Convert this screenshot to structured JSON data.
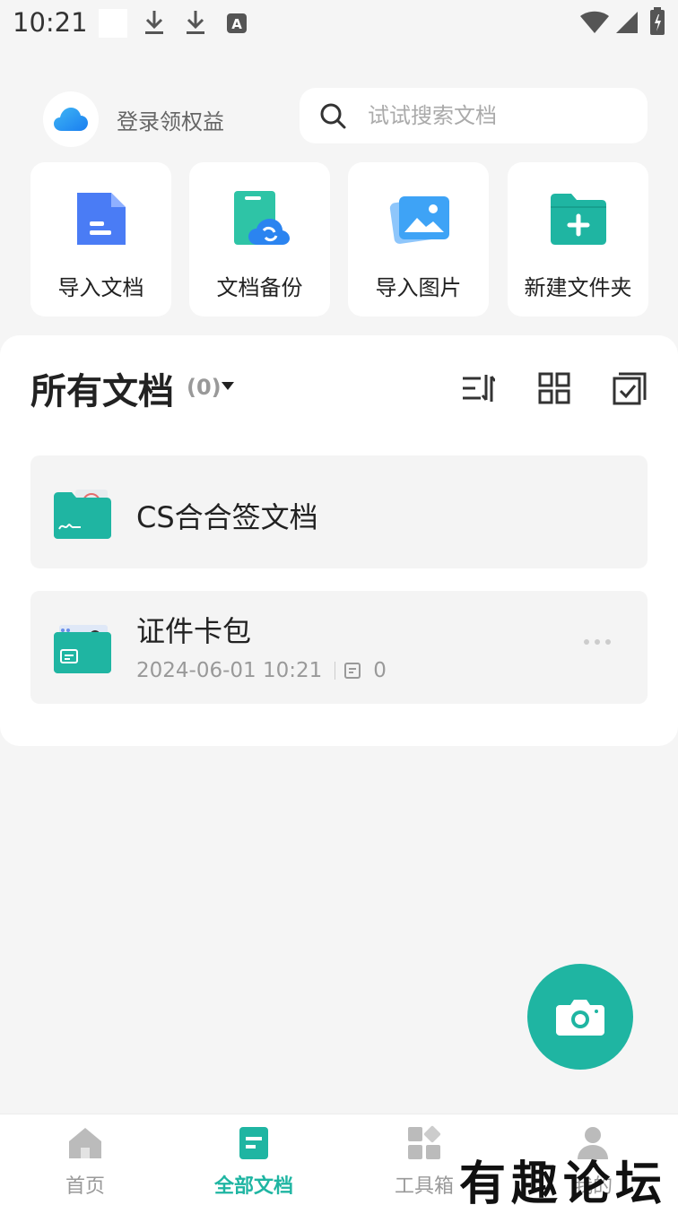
{
  "status_bar": {
    "time": "10:21"
  },
  "account": {
    "label": "登录领权益"
  },
  "search": {
    "placeholder": "试试搜索文档"
  },
  "quick_actions": [
    {
      "label": "导入文档",
      "icon": "import-document-icon"
    },
    {
      "label": "文档备份",
      "icon": "document-backup-icon"
    },
    {
      "label": "导入图片",
      "icon": "import-image-icon"
    },
    {
      "label": "新建文件夹",
      "icon": "new-folder-icon"
    }
  ],
  "panel": {
    "title": "所有文档",
    "count": "(0)"
  },
  "documents": [
    {
      "name": "CS合合签文档",
      "icon": "signature-folder-icon"
    },
    {
      "name": "证件卡包",
      "date": "2024-06-01 10:21",
      "page_count": "0",
      "icon": "id-card-folder-icon"
    }
  ],
  "tabs": [
    {
      "label": "首页",
      "icon": "home-icon"
    },
    {
      "label": "全部文档",
      "icon": "all-documents-icon",
      "active": true
    },
    {
      "label": "工具箱",
      "icon": "toolbox-icon"
    },
    {
      "label": "我的",
      "icon": "profile-icon"
    }
  ],
  "watermark": "有趣论坛",
  "colors": {
    "accent": "#1fb5a2",
    "background": "#f5f5f5"
  }
}
